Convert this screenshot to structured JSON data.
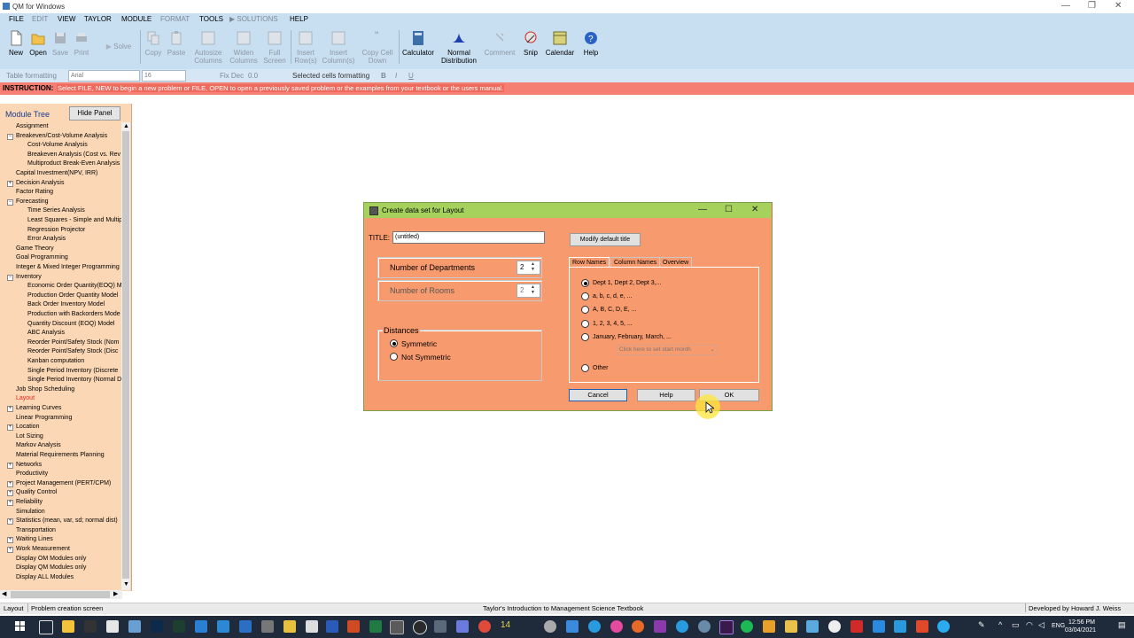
{
  "window": {
    "title": "QM for Windows",
    "controls": [
      "—",
      "❐",
      "✕"
    ]
  },
  "menu": [
    {
      "label": "FILE",
      "enabled": true
    },
    {
      "label": "EDIT",
      "enabled": false
    },
    {
      "label": "VIEW",
      "enabled": true
    },
    {
      "label": "TAYLOR",
      "enabled": true
    },
    {
      "label": "MODULE",
      "enabled": true
    },
    {
      "label": "FORMAT",
      "enabled": false
    },
    {
      "label": "TOOLS",
      "enabled": true
    },
    {
      "label": "SOLUTIONS",
      "enabled": false
    },
    {
      "label": "HELP",
      "enabled": true
    }
  ],
  "toolbar": {
    "new": "New",
    "open": "Open",
    "save": "Save",
    "print": "Print",
    "solve": "Solve",
    "copy": "Copy",
    "paste": "Paste",
    "autosize_1": "Autosize",
    "autosize_2": "Columns",
    "widen_1": "Widen",
    "widen_2": "Columns",
    "full_1": "Full",
    "full_2": "Screen",
    "insert_row_1": "Insert",
    "insert_row_2": "Row(s)",
    "insert_col_1": "Insert",
    "insert_col_2": "Column(s)",
    "copy_cell_1": "Copy Cell",
    "copy_cell_2": "Down",
    "calculator": "Calculator",
    "normal_1": "Normal",
    "normal_2": "Distribution",
    "comment": "Comment",
    "snip": "Snip",
    "calendar": "Calendar",
    "help": "Help"
  },
  "formatbar": {
    "table_formatting": "Table formatting",
    "font": "Arial",
    "size": "16",
    "fix_dec": "Fix Dec",
    "dec_value": "0.0",
    "selected_cells": "Selected cells formatting"
  },
  "instruction": {
    "label": "INSTRUCTION:",
    "text": "Select FILE, NEW to begin a new problem or FILE, OPEN to open a previously saved problem or the examples from your textbook or the users manual."
  },
  "module_tree": {
    "title": "Module Tree",
    "hide_panel": "Hide Panel",
    "items": [
      {
        "label": "Assignment",
        "level": 1
      },
      {
        "label": "Breakeven/Cost-Volume Analysis",
        "level": 1,
        "expander": "−"
      },
      {
        "label": "Cost-Volume Analysis",
        "level": 2
      },
      {
        "label": "Breakeven Analysis (Cost vs. Rev",
        "level": 2
      },
      {
        "label": "Multiproduct Break-Even Analysis",
        "level": 2
      },
      {
        "label": "Capital Investment(NPV, IRR)",
        "level": 1
      },
      {
        "label": "Decision Analysis",
        "level": 1,
        "expander": "+"
      },
      {
        "label": "Factor Rating",
        "level": 1
      },
      {
        "label": "Forecasting",
        "level": 1,
        "expander": "−"
      },
      {
        "label": "Time Series Analysis",
        "level": 2
      },
      {
        "label": "Least Squares - Simple and Multip",
        "level": 2
      },
      {
        "label": "Regression Projector",
        "level": 2
      },
      {
        "label": "Error Analysis",
        "level": 2
      },
      {
        "label": "Game Theory",
        "level": 1
      },
      {
        "label": "Goal Programming",
        "level": 1
      },
      {
        "label": "Integer & Mixed Integer Programming",
        "level": 1
      },
      {
        "label": "Inventory",
        "level": 1,
        "expander": "−"
      },
      {
        "label": "Economic Order Quantity(EOQ) M",
        "level": 2
      },
      {
        "label": "Production Order Quantity Model",
        "level": 2
      },
      {
        "label": "Back Order Inventory Model",
        "level": 2
      },
      {
        "label": "Production with Backorders Mode",
        "level": 2
      },
      {
        "label": "Quantity Discount (EOQ) Model",
        "level": 2
      },
      {
        "label": "ABC Analysis",
        "level": 2
      },
      {
        "label": "Reorder Point/Safety Stock (Nom",
        "level": 2
      },
      {
        "label": "Reorder Point/Safety Stock (Disc",
        "level": 2
      },
      {
        "label": "Kanban computation",
        "level": 2
      },
      {
        "label": "Single Period Inventory (Discrete",
        "level": 2
      },
      {
        "label": "Single Period Inventory (Normal D",
        "level": 2
      },
      {
        "label": "Job Shop Scheduling",
        "level": 1
      },
      {
        "label": "Layout",
        "level": 1,
        "active": true
      },
      {
        "label": "Learning Curves",
        "level": 1,
        "expander": "+"
      },
      {
        "label": "Linear Programming",
        "level": 1
      },
      {
        "label": "Location",
        "level": 1,
        "expander": "+"
      },
      {
        "label": "Lot Sizing",
        "level": 1
      },
      {
        "label": "Markov Analysis",
        "level": 1
      },
      {
        "label": "Material Requirements Planning",
        "level": 1
      },
      {
        "label": "Networks",
        "level": 1,
        "expander": "+"
      },
      {
        "label": "Productivity",
        "level": 1
      },
      {
        "label": "Project Management (PERT/CPM)",
        "level": 1,
        "expander": "+"
      },
      {
        "label": "Quality Control",
        "level": 1,
        "expander": "+"
      },
      {
        "label": "Reliability",
        "level": 1,
        "expander": "+"
      },
      {
        "label": "Simulation",
        "level": 1
      },
      {
        "label": "Statistics (mean, var, sd; normal dist)",
        "level": 1,
        "expander": "+"
      },
      {
        "label": "Transportation",
        "level": 1
      },
      {
        "label": "Waiting Lines",
        "level": 1,
        "expander": "+"
      },
      {
        "label": "Work Measurement",
        "level": 1,
        "expander": "+"
      },
      {
        "label": "Display OM Modules only",
        "level": 1
      },
      {
        "label": "Display QM Modules only",
        "level": 1
      },
      {
        "label": "Display ALL Modules",
        "level": 1
      }
    ]
  },
  "dialog": {
    "title": "Create data set for Layout",
    "title_label": "TITLE:",
    "title_value": "(untitled)",
    "modify_title": "Modify default title",
    "num_departments_label": "Number of Departments",
    "num_departments": "2",
    "num_rooms_label": "Number of Rooms",
    "num_rooms": "2",
    "distances_label": "Distances",
    "distances_options": [
      "Symmetric",
      "Not Symmetric"
    ],
    "distances_selected": "Symmetric",
    "tabs": [
      "Row Names",
      "Column Names",
      "Overview"
    ],
    "active_tab": "Row Names",
    "row_name_options": [
      "Dept 1, Dept 2, Dept 3,...",
      "a, b, c, d, e, ...",
      "A, B, C, D, E, ...",
      "1, 2, 3, 4, 5, ...",
      "January, February, March, ...",
      "Other"
    ],
    "row_name_selected": "Dept 1, Dept 2, Dept 3,...",
    "month_placeholder": "Click here to set start month",
    "cancel": "Cancel",
    "help": "Help",
    "ok": "OK"
  },
  "statusbar": {
    "module": "Layout",
    "screen": "Problem creation screen",
    "textbook": "Taylor's Introduction to Management Science Textbook",
    "developer": "Developed by Howard J. Weiss"
  },
  "taskbar": {
    "lang": "ENG",
    "time": "12:56 PM",
    "date": "03/04/2021"
  },
  "colors": {
    "menu_bg": "#c8dff2",
    "instruction_bg": "#f47f72",
    "tree_bg": "#fbd7b5",
    "dialog_bg": "#f79a6e",
    "dialog_title_bg": "#a5d15c",
    "active_tree_item": "#e8251a"
  }
}
